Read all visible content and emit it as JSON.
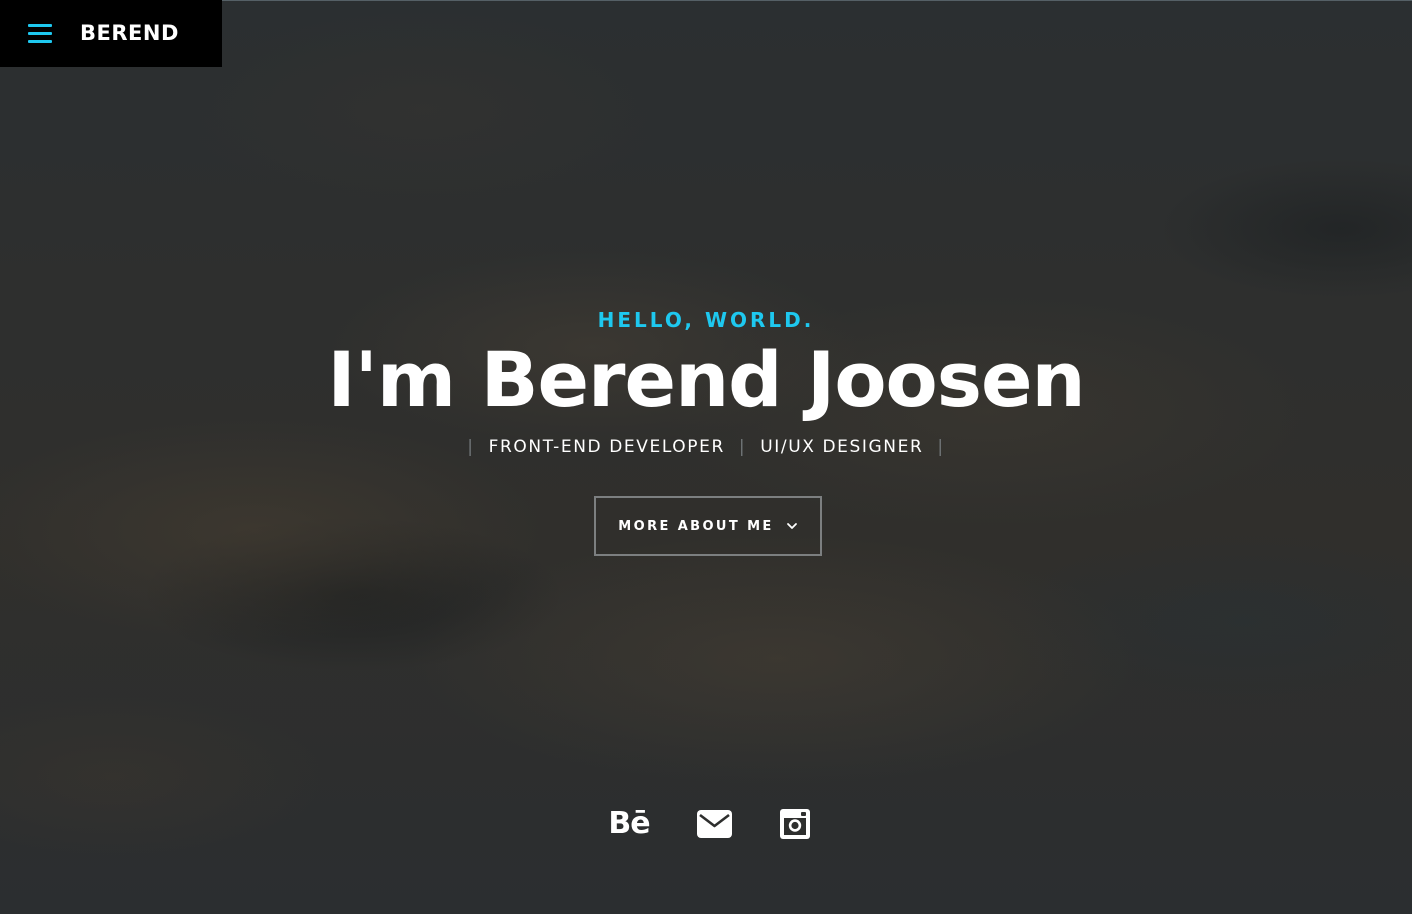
{
  "header": {
    "brand": "BEREND",
    "menu_icon": "hamburger-menu-icon"
  },
  "hero": {
    "greeting": "HELLO, WORLD.",
    "headline": "I'm Berend Joosen",
    "roles": [
      "FRONT-END DEVELOPER",
      "UI/UX DESIGNER"
    ],
    "separator": "|",
    "cta_label": "MORE ABOUT ME",
    "cta_icon": "chevron-down-icon"
  },
  "social": [
    {
      "name": "behance",
      "label": "Bē",
      "icon": "behance-icon"
    },
    {
      "name": "email",
      "icon": "envelope-icon"
    },
    {
      "name": "instagram",
      "icon": "instagram-icon"
    }
  ],
  "colors": {
    "accent": "#1ec8ef",
    "background": "#2e2f2e",
    "brand_bar": "#000000",
    "text": "#ffffff",
    "button_border": "#7c7f80"
  }
}
